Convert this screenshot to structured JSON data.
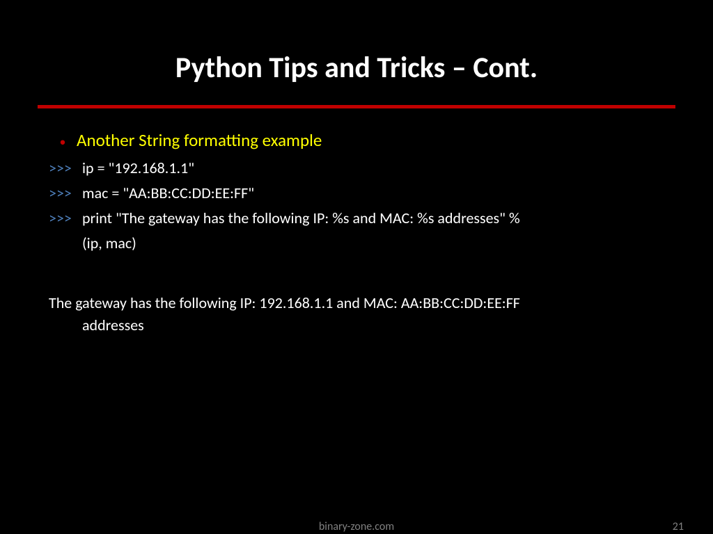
{
  "title": "Python Tips and Tricks – Cont.",
  "bullet": {
    "dot": "•",
    "text": "Another String formatting example"
  },
  "code": {
    "prompt": ">>>",
    "line1": "ip = \"192.168.1.1\"",
    "line2": "mac = \"AA:BB:CC:DD:EE:FF\"",
    "line3": "print \"The gateway has the following IP: %s and MAC: %s addresses\" %",
    "line3wrap": "(ip, mac)"
  },
  "output": {
    "line1": "The gateway has the following IP: 192.168.1.1 and MAC: AA:BB:CC:DD:EE:FF",
    "line2": "addresses"
  },
  "footer": {
    "site": "binary-zone.com",
    "page": "21"
  }
}
